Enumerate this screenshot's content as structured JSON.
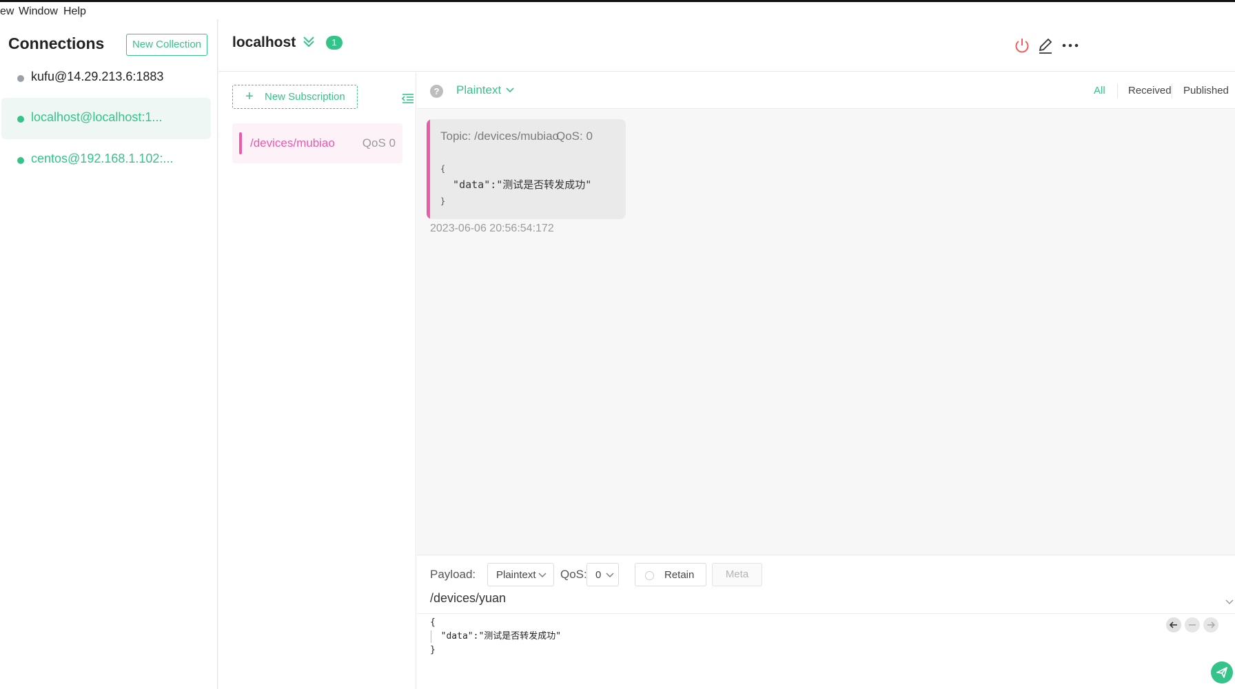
{
  "menu": {
    "items": [
      "ew",
      "Window",
      "Help"
    ]
  },
  "sidebar": {
    "title": "Connections",
    "new_collection_label": "New Collection",
    "connections": [
      {
        "label": "kufu@14.29.213.6:1883",
        "status_color": "#9aa0a6",
        "text_color": "#222222",
        "active": false
      },
      {
        "label": "localhost@localhost:1...",
        "status_color": "#34c388",
        "text_color": "#34c388",
        "active": true
      },
      {
        "label": "centos@192.168.1.102:...",
        "status_color": "#34c388",
        "text_color": "#34c388",
        "active": false
      }
    ]
  },
  "header": {
    "title": "localhost",
    "badge": "1",
    "icons": [
      "double-chevron-down-icon",
      "power-icon",
      "edit-icon",
      "more-icon"
    ]
  },
  "subscriptions": {
    "new_label": "New Subscription",
    "items": [
      {
        "topic": "/devices/mubiao",
        "qos": "QoS 0",
        "color": "#ea5aaa"
      }
    ]
  },
  "messages": {
    "help": "?",
    "format": "Plaintext",
    "filters": [
      "All",
      "Received",
      "Published"
    ],
    "active_filter": "All",
    "list": [
      {
        "topic": "Topic: /devices/mubiao",
        "qos": "QoS: 0",
        "line1": "{",
        "line2": "  \"data\":\"测试是否转发成功\"",
        "line3": "}",
        "time": "2023-06-06 20:56:54:172"
      }
    ]
  },
  "publish": {
    "payload_label": "Payload:",
    "payload_format": "Plaintext",
    "qos_label": "QoS:",
    "qos_value": "0",
    "retain_label": "Retain",
    "meta_label": "Meta",
    "topic": "/devices/yuan",
    "payload_line1": "{",
    "payload_line2": "  \"data\":\"测试是否转发成功\"",
    "payload_line3": "}"
  },
  "colors": {
    "accent": "#34c388",
    "topic_pink": "#ea5aaa",
    "power_red": "#f15c5c"
  }
}
